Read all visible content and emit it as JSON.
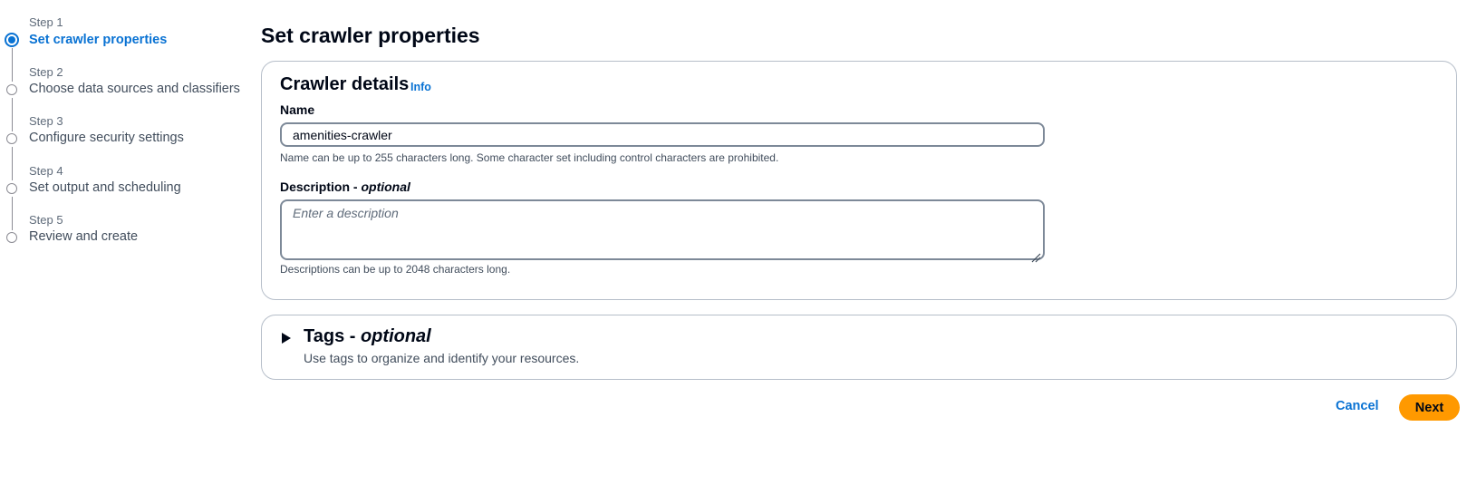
{
  "steps": [
    {
      "label": "Step 1",
      "title": "Set crawler properties",
      "active": true
    },
    {
      "label": "Step 2",
      "title": "Choose data sources and classifiers",
      "active": false
    },
    {
      "label": "Step 3",
      "title": "Configure security settings",
      "active": false
    },
    {
      "label": "Step 4",
      "title": "Set output and scheduling",
      "active": false
    },
    {
      "label": "Step 5",
      "title": "Review and create",
      "active": false
    }
  ],
  "page_title": "Set crawler properties",
  "crawler_details": {
    "title": "Crawler details",
    "info_link": "Info",
    "name": {
      "label": "Name",
      "value": "amenities-crawler",
      "hint": "Name can be up to 255 characters long. Some character set including control characters are prohibited."
    },
    "description": {
      "label": "Description - ",
      "label_optional": "optional",
      "placeholder": "Enter a description",
      "hint": "Descriptions can be up to 2048 characters long."
    }
  },
  "tags": {
    "title": "Tags - ",
    "title_optional": "optional",
    "description": "Use tags to organize and identify your resources.",
    "caret_icon": "caret-right-icon"
  },
  "actions": {
    "cancel_label": "Cancel",
    "next_label": "Next"
  },
  "colors": {
    "accent": "#0972d3",
    "primary_button": "#ff9900",
    "border": "#b6bec9"
  }
}
